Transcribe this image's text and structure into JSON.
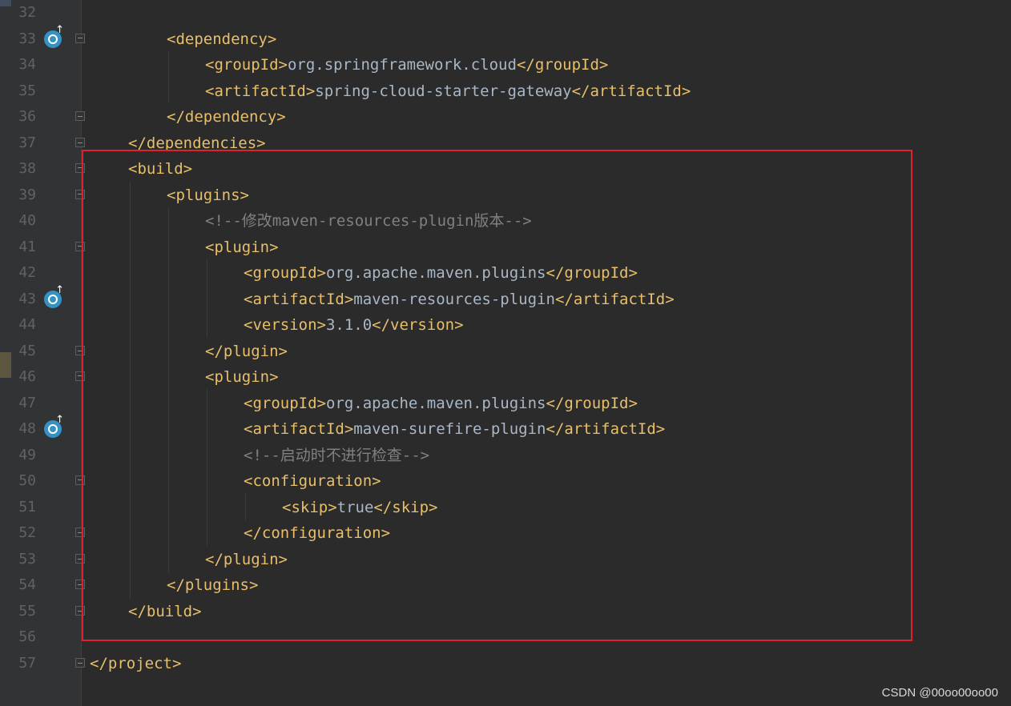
{
  "editor": {
    "lines": [
      {
        "num": "32"
      },
      {
        "num": "33",
        "gutter_icon": "maven-reload-icon",
        "fold": "open",
        "tag_open": "<dependency>"
      },
      {
        "num": "34",
        "tag_open": "<groupId>",
        "text": "org.springframework.cloud",
        "tag_close": "</groupId>"
      },
      {
        "num": "35",
        "tag_open": "<artifactId>",
        "text": "spring-cloud-starter-gateway",
        "tag_close": "</artifactId>"
      },
      {
        "num": "36",
        "fold": "close",
        "tag_open": "</dependency>"
      },
      {
        "num": "37",
        "fold": "close",
        "tag_open": "</dependencies>"
      },
      {
        "num": "38",
        "fold": "open",
        "tag_open": "<build>"
      },
      {
        "num": "39",
        "fold": "open",
        "tag_open": "<plugins>"
      },
      {
        "num": "40",
        "comment": "<!--修改maven-resources-plugin版本-->"
      },
      {
        "num": "41",
        "fold": "open",
        "tag_open": "<plugin>"
      },
      {
        "num": "42",
        "tag_open": "<groupId>",
        "text": "org.apache.maven.plugins",
        "tag_close": "</groupId>"
      },
      {
        "num": "43",
        "gutter_icon": "maven-reload-icon",
        "tag_open": "<artifactId>",
        "text": "maven-resources-plugin",
        "tag_close": "</artifactId>"
      },
      {
        "num": "44",
        "tag_open": "<version>",
        "text": "3.1.0",
        "tag_close": "</version>"
      },
      {
        "num": "45",
        "fold": "close",
        "tag_open": "</plugin>"
      },
      {
        "num": "46",
        "fold": "open",
        "tag_open": "<plugin>"
      },
      {
        "num": "47",
        "tag_open": "<groupId>",
        "text": "org.apache.maven.plugins",
        "tag_close": "</groupId>"
      },
      {
        "num": "48",
        "gutter_icon": "maven-reload-icon",
        "tag_open": "<artifactId>",
        "text": "maven-surefire-plugin",
        "tag_close": "</artifactId>"
      },
      {
        "num": "49",
        "comment": "<!--启动时不进行检查-->"
      },
      {
        "num": "50",
        "fold": "open",
        "tag_open": "<configuration>"
      },
      {
        "num": "51",
        "tag_open": "<skip>",
        "text": "true",
        "tag_close": "</skip>"
      },
      {
        "num": "52",
        "fold": "close",
        "tag_open": "</configuration>"
      },
      {
        "num": "53",
        "fold": "close",
        "tag_open": "</plugin>"
      },
      {
        "num": "54",
        "fold": "close",
        "tag_open": "</plugins>"
      },
      {
        "num": "55",
        "fold": "close",
        "tag_open": "</build>"
      },
      {
        "num": "56"
      },
      {
        "num": "57",
        "fold": "close",
        "tag_open": "</project>"
      }
    ]
  },
  "watermark": "CSDN @00oo00oo00",
  "colors": {
    "background": "#2b2b2b",
    "gutter": "#313335",
    "tag": "#e8bf6a",
    "text": "#a9b7c6",
    "comment": "#808080",
    "line_number": "#606366",
    "highlight_box": "#e0212b",
    "gutter_icon": "#3592c4"
  }
}
